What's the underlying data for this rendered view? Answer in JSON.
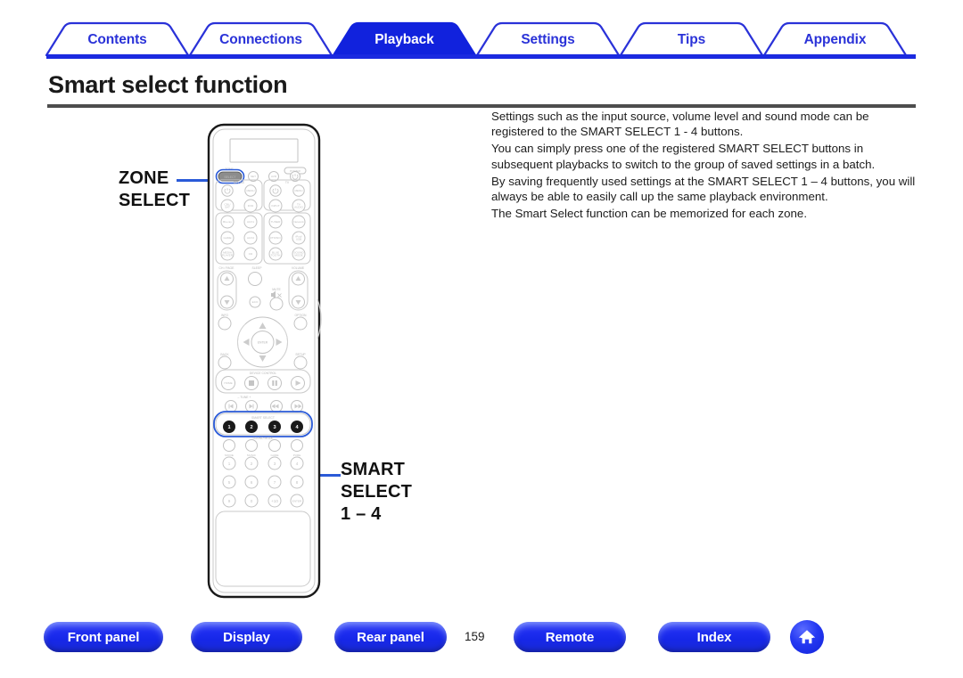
{
  "tabs": [
    {
      "label": "Contents",
      "active": false,
      "name": "tab-contents"
    },
    {
      "label": "Connections",
      "active": false,
      "name": "tab-connections"
    },
    {
      "label": "Playback",
      "active": true,
      "name": "tab-playback"
    },
    {
      "label": "Settings",
      "active": false,
      "name": "tab-settings"
    },
    {
      "label": "Tips",
      "active": false,
      "name": "tab-tips"
    },
    {
      "label": "Appendix",
      "active": false,
      "name": "tab-appendix"
    }
  ],
  "page": {
    "title": "Smart select function",
    "number": "159"
  },
  "body": {
    "paragraphs": [
      "Settings such as the input source, volume level and sound mode can be registered to the SMART SELECT 1 - 4 buttons.",
      "You can simply press one of the registered SMART SELECT buttons in subsequent playbacks to switch to the group of saved settings in a batch.",
      "By saving frequently used settings at the SMART SELECT 1 – 4 buttons, you will always be able to easily call up the same playback environment.",
      "The Smart Select function can be memorized for each zone."
    ]
  },
  "callouts": {
    "zone": "ZONE\nSELECT",
    "zone_line1": "ZONE",
    "zone_line2": "SELECT",
    "smart_line1": "SMART",
    "smart_line2": "SELECT",
    "smart_line3": "1 – 4"
  },
  "remote": {
    "zone_group_label": "ZONE",
    "zone_select_button": "SELECT",
    "power_label": "POWER",
    "device_label": "DEVICE",
    "tv_label": "TV",
    "set_button": "SET",
    "avr_button": "AVR",
    "device_menu": "MENU",
    "tv_menu": "MENU",
    "tv_input": "INPUT",
    "tv_audio": "TV AUDIO",
    "sources": [
      "CBL/SAT",
      "DVD",
      "Blu-ray",
      "AUX1",
      "GAME",
      "AUX2",
      "MEDIA PLAYER",
      "CD",
      "TUNER",
      "Network",
      "PHONO",
      "iPod/USB",
      "BLUE TOOTH",
      "SOUND MODE"
    ],
    "ch_page_label": "CH / PAGE",
    "sleep_label": "SLEEP",
    "volume_label": "VOLUME",
    "mute_label": "MUTE",
    "eco_button": "ECO",
    "info_button": "INFO",
    "option_button": "OPTION",
    "back_button": "BACK",
    "setup_button": "SETUP",
    "enter_button": "ENTER",
    "device_control_label": "DEVICE CONTROL",
    "home_button": "HOME",
    "tune_label": "TUNE",
    "smart_select_label": "SMART SELECT",
    "smart_buttons": [
      "1",
      "2",
      "3",
      "4"
    ],
    "sound_mode_label": "SOUND MODE",
    "sound_modes": [
      "MOVIE",
      "MUSIC",
      "GAME",
      "PURE"
    ],
    "numpad": [
      "1",
      "2",
      "3",
      "4",
      "5",
      "6",
      "7",
      "8",
      "9",
      "0",
      "+10",
      "ENTER"
    ]
  },
  "footer": {
    "buttons": [
      {
        "label": "Front panel",
        "name": "front-panel-button"
      },
      {
        "label": "Display",
        "name": "display-button"
      },
      {
        "label": "Rear panel",
        "name": "rear-panel-button"
      },
      {
        "label": "Remote",
        "name": "remote-button"
      },
      {
        "label": "Index",
        "name": "index-button"
      }
    ],
    "home_icon": "home-icon"
  },
  "colors": {
    "accent": "#2a32d8",
    "active_tab": "#1122dd",
    "highlight": "#2a5ad8",
    "rule": "#4d4d4d"
  }
}
